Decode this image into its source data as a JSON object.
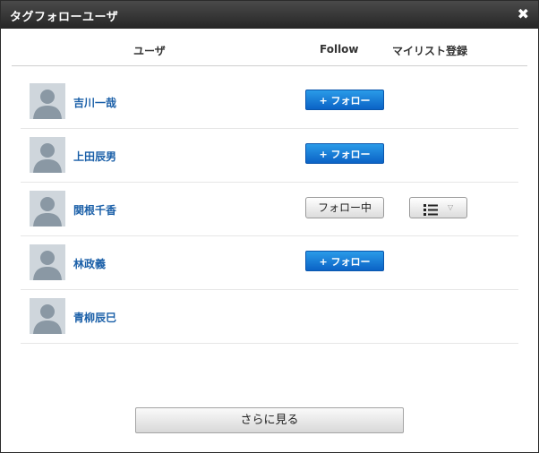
{
  "dialog": {
    "title": "タグフォローユーザ",
    "close_glyph": "✖"
  },
  "columns": {
    "user": "ユーザ",
    "follow": "Follow",
    "mylist": "マイリスト登録"
  },
  "users": [
    {
      "name": "吉川一哉",
      "follow_label": "+ フォロー",
      "following": false
    },
    {
      "name": "上田辰男",
      "follow_label": "+ フォロー",
      "following": false
    },
    {
      "name": "関根千香",
      "follow_label": "フォロー中",
      "following": true,
      "mylist_icon": "list-icon"
    },
    {
      "name": "林政義",
      "follow_label": "+ フォロー",
      "following": false
    },
    {
      "name": "青柳辰巳",
      "follow_label": "",
      "following": false
    }
  ],
  "more_button": "さらに見る",
  "colors": {
    "titlebar": "#2f2f2f",
    "link": "#1a5fa8",
    "follow_button": "#0b63c6"
  }
}
